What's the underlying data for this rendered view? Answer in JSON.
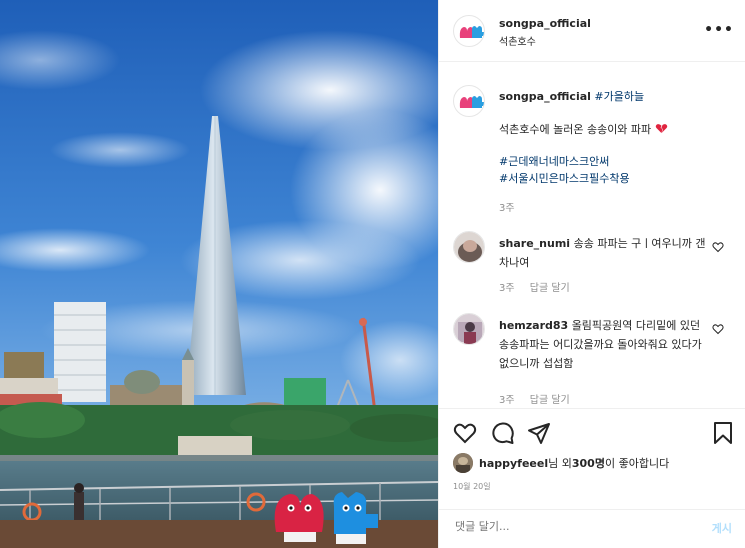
{
  "post": {
    "username": "songpa_official",
    "location": "석촌호수",
    "more_label": "•••",
    "caption": {
      "username": "songpa_official",
      "hashtag_main": "#가을하늘",
      "text": "석촌호수에 놀러온 송송이와 파파",
      "hashtags": [
        "#근데왜너네마스크안써",
        "#서울시민은마스크필수착용"
      ],
      "age": "3주"
    },
    "comments": [
      {
        "username": "share_numi",
        "text": "송송 파파는 구ㅣ여우니까 갠차나여",
        "age": "3주",
        "reply_label": "답글 달기"
      },
      {
        "username": "hemzard83",
        "text": "올림픽공원역 다리밑에 있던 송송파파는 어디갔을까요 돌아와줘요 있다가 없으니까 섭섭함",
        "age": "3주",
        "reply_label": "답글 달기"
      }
    ],
    "likes": {
      "username": "happyfeeel",
      "middle": "님 외 ",
      "count": "300명",
      "suffix": "이 좋아합니다"
    },
    "date": "10월 20일",
    "comment_input": {
      "placeholder": "댓글 달기..."
    },
    "post_button": "게시"
  },
  "icons": {
    "header": [
      "songpa-logo-icon",
      "more-options-icon"
    ],
    "actions": [
      "heart-icon",
      "comment-icon",
      "share-icon",
      "bookmark-icon"
    ]
  },
  "colors": {
    "text": "#262626",
    "muted": "#8e8e8e",
    "hashtag": "#00376b",
    "post_button": "#b2dffc",
    "logo_pink": "#e8417b",
    "logo_blue": "#2a9ee0"
  }
}
